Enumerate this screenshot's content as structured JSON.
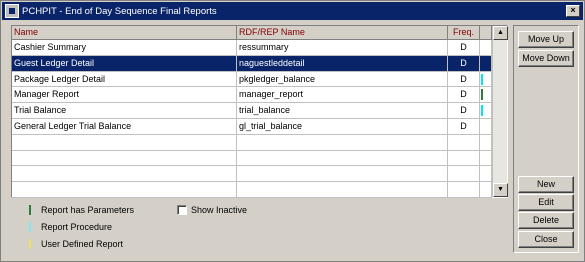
{
  "window": {
    "title": "PCHPIT - End of Day Sequence Final Reports",
    "close": "×"
  },
  "table": {
    "headers": [
      "Name",
      "RDF/REP Name",
      "Freq.",
      ""
    ],
    "rows": [
      {
        "name": "Cashier Summary",
        "rdf": "ressummary",
        "freq": "D",
        "mark": ""
      },
      {
        "name": "Guest Ledger Detail",
        "rdf": "naguestleddetail",
        "freq": "D",
        "mark": ""
      },
      {
        "name": "Package Ledger Detail",
        "rdf": "pkgledger_balance",
        "freq": "D",
        "mark": "#00e5ff"
      },
      {
        "name": "Manager Report",
        "rdf": "manager_report",
        "freq": "D",
        "mark": "#2e7d32"
      },
      {
        "name": "Trial Balance",
        "rdf": "trial_balance",
        "freq": "D",
        "mark": "#00e5ff"
      },
      {
        "name": "General Ledger Trial Balance",
        "rdf": "gl_trial_balance",
        "freq": "D",
        "mark": ""
      },
      {
        "name": "",
        "rdf": "",
        "freq": "",
        "mark": ""
      },
      {
        "name": "",
        "rdf": "",
        "freq": "",
        "mark": ""
      },
      {
        "name": "",
        "rdf": "",
        "freq": "",
        "mark": ""
      },
      {
        "name": "",
        "rdf": "",
        "freq": "",
        "mark": ""
      }
    ],
    "selected_row": 1
  },
  "buttons": {
    "move_up": "Move Up",
    "move_down": "Move Down",
    "new": "New",
    "edit": "Edit",
    "delete": "Delete",
    "close": "Close"
  },
  "legend": [
    {
      "label": "Report has Parameters",
      "color": "#2e7d32"
    },
    {
      "label": "Report Procedure",
      "color": "#7fe8f0"
    },
    {
      "label": "User Defined Report",
      "color": "#f0e060"
    }
  ],
  "show_inactive": {
    "label": "Show Inactive",
    "checked": false
  }
}
